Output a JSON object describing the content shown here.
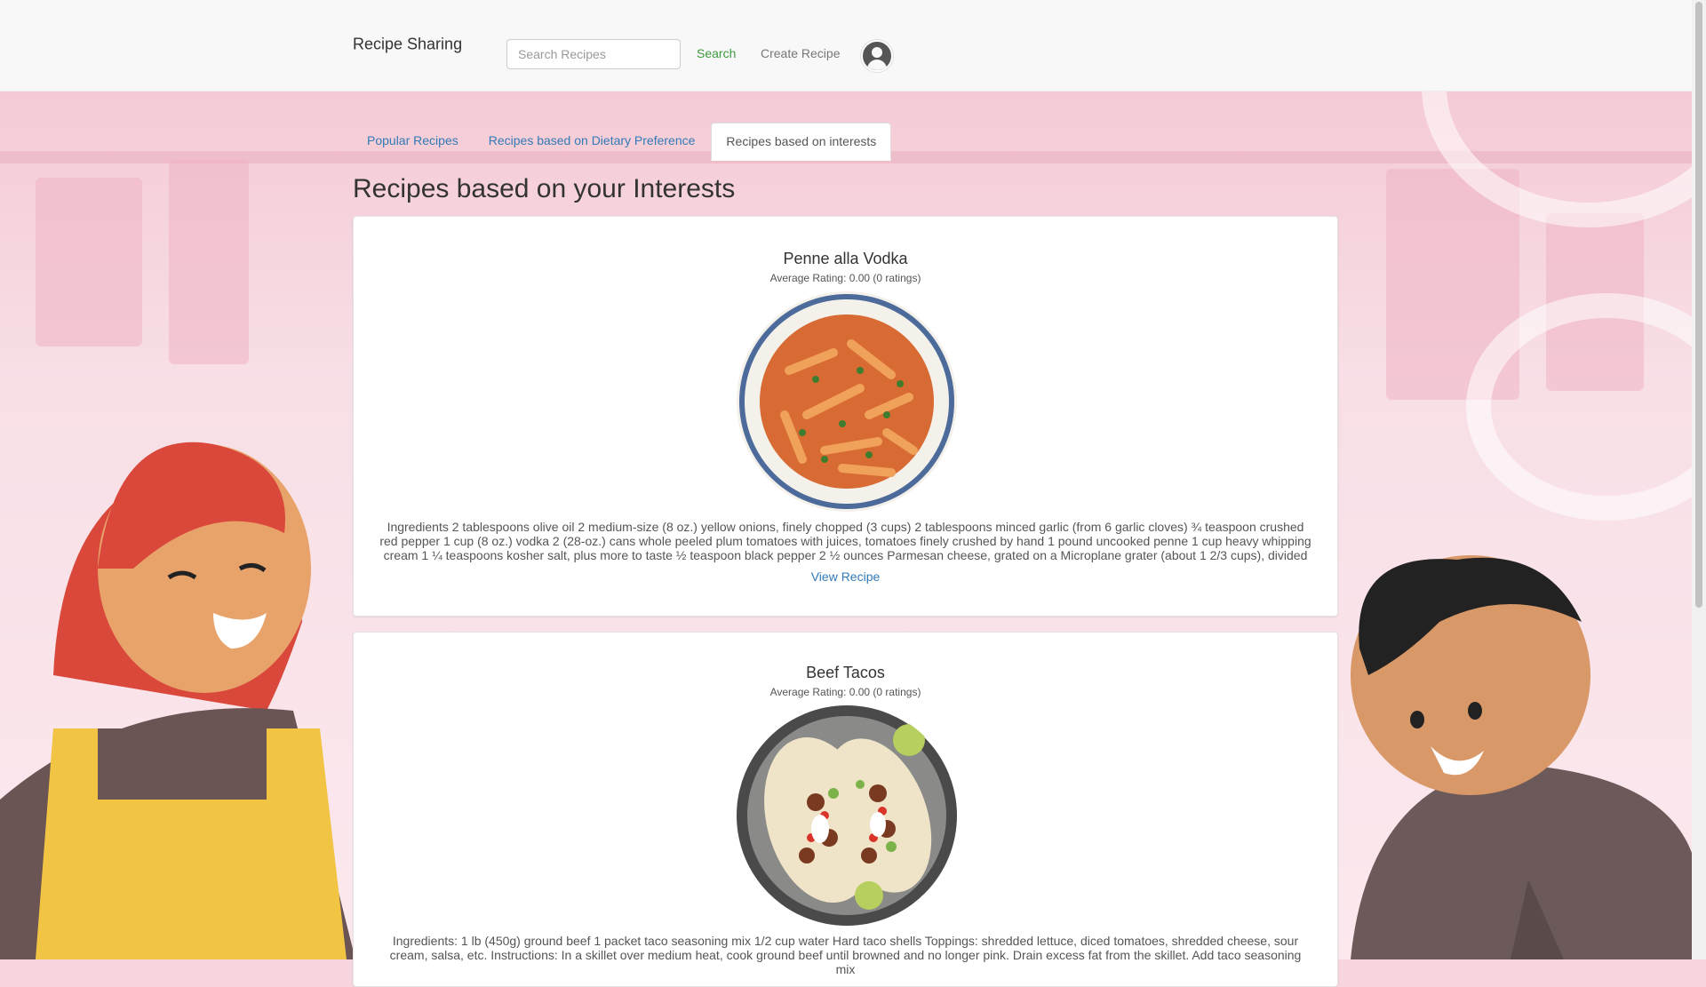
{
  "navbar": {
    "brand": "Recipe Sharing",
    "search_placeholder": "Search Recipes",
    "search_label": "Search",
    "create_label": "Create Recipe"
  },
  "tabs": [
    {
      "label": "Popular Recipes",
      "active": false
    },
    {
      "label": "Recipes based on Dietary Preference",
      "active": false
    },
    {
      "label": "Recipes based on interests",
      "active": true
    }
  ],
  "page": {
    "heading": "Recipes based on your Interests"
  },
  "recipes": [
    {
      "title": "Penne alla Vodka",
      "rating": "Average Rating: 0.00 (0 ratings)",
      "ingredients": "Ingredients 2 tablespoons olive oil 2 medium-size (8 oz.) yellow onions, finely chopped (3 cups) 2 tablespoons minced garlic (from 6 garlic cloves) ¾ teaspoon crushed red pepper 1 cup (8 oz.) vodka 2 (28-oz.) cans whole peeled plum tomatoes with juices, tomatoes finely crushed by hand 1 pound uncooked penne 1 cup heavy whipping cream 1 ¼ teaspoons kosher salt, plus more to taste ½ teaspoon black pepper 2 ½ ounces Parmesan cheese, grated on a Microplane grater (about 1 2/3 cups), divided",
      "view_label": "View Recipe"
    },
    {
      "title": "Beef Tacos",
      "rating": "Average Rating: 0.00 (0 ratings)",
      "ingredients": "Ingredients: 1 lb (450g) ground beef 1 packet taco seasoning mix 1/2 cup water Hard taco shells Toppings: shredded lettuce, diced tomatoes, shredded cheese, sour cream, salsa, etc. Instructions: In a skillet over medium heat, cook ground beef until browned and no longer pink. Drain excess fat from the skillet. Add taco seasoning mix"
    }
  ],
  "colors": {
    "brand_text": "#333333",
    "search_green": "#3c9a3c",
    "link_blue": "#337ab7",
    "background_pink": "#f7d6df"
  },
  "icons": {
    "avatar": "user-circle-icon"
  }
}
